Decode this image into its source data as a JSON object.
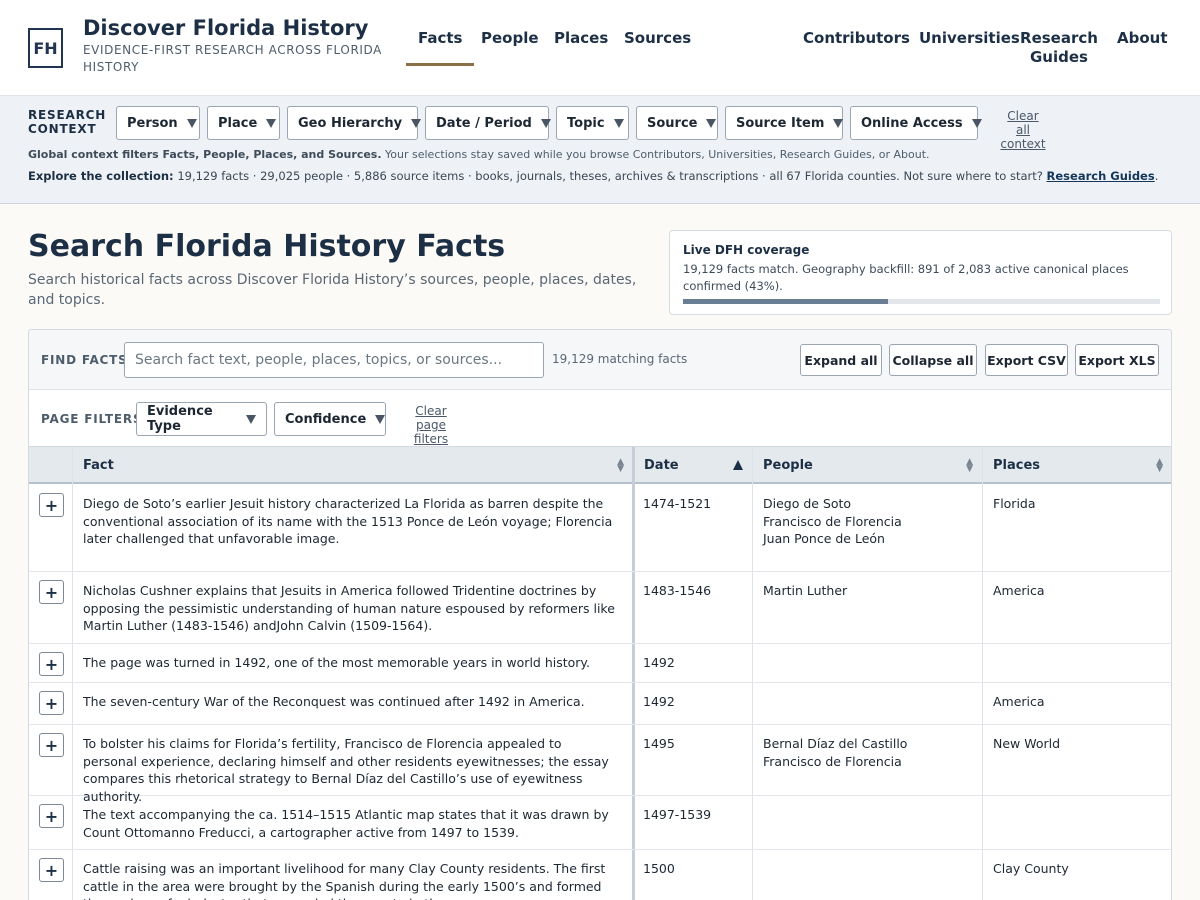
{
  "header": {
    "logo": "FH",
    "title": "Discover Florida History",
    "tagline": "EVIDENCE-FIRST RESEARCH ACROSS FLORIDA HISTORY",
    "nav_primary": [
      "Facts",
      "People",
      "Places",
      "Sources"
    ],
    "nav_secondary": [
      "Contributors",
      "Universities",
      "Research Guides",
      "About"
    ],
    "active_nav": "Facts"
  },
  "context": {
    "label": "RESEARCH CONTEXT",
    "filters": [
      "Person",
      "Place",
      "Geo Hierarchy",
      "Date / Period",
      "Topic",
      "Source",
      "Source Item",
      "Online Access"
    ],
    "clear_label": "Clear all context",
    "note_bold": "Global context filters Facts, People, Places, and Sources.",
    "note_rest": " Your selections stay saved while you browse Contributors, Universities, Research Guides, or About.",
    "stats_label": "Explore the collection:",
    "stats_text": "19,129 facts · 29,025 people · 5,886 source items · books, journals, theses, archives & transcriptions · all 67 Florida counties.  Not sure where to start?",
    "stats_link": "Research Guides",
    "stats_end": "."
  },
  "page": {
    "title": "Search Florida History Facts",
    "subtitle": "Search historical facts across Discover Florida History’s sources, people, places, dates, and topics."
  },
  "coverage": {
    "title": "Live DFH coverage",
    "text": "19,129 facts match. Geography backfill: 891 of 2,083 active canonical places confirmed (43%).",
    "percent": 43
  },
  "find": {
    "label": "FIND FACTS",
    "placeholder": "Search fact text, people, places, topics, or sources...",
    "value": "",
    "count": "19,129 matching facts",
    "expand_all": "Expand all",
    "collapse_all": "Collapse all",
    "export_csv": "Export CSV",
    "export_xls": "Export XLS"
  },
  "page_filters": {
    "label": "PAGE FILTERS",
    "evidence": "Evidence Type",
    "confidence": "Confidence",
    "clear": "Clear page filters"
  },
  "table": {
    "columns": [
      "Fact",
      "Date",
      "People",
      "Places"
    ],
    "sorted_column": "Date",
    "expand_symbol": "+",
    "rows": [
      {
        "fact": "Diego de Soto’s earlier Jesuit history characterized La Florida as barren despite the conventional association of its name with the 1513 Ponce de León voyage; Florencia later challenged that unfavorable image.",
        "date": "1474-1521",
        "people": "Diego de Soto\nFrancisco de Florencia\nJuan Ponce de León",
        "places": "Florida"
      },
      {
        "fact": "Nicholas Cushner explains that Jesuits in America followed Tridentine doctrines by opposing the pessimistic understanding of human nature espoused by reformers like Martin Luther (1483-1546) andJohn Calvin (1509-1564).",
        "date": "1483-1546",
        "people": "Martin Luther",
        "places": "America"
      },
      {
        "fact": "The page was turned in 1492, one of the most memorable years in world history.",
        "date": "1492",
        "people": "",
        "places": ""
      },
      {
        "fact": "The seven-century War of the Reconquest was continued after 1492 in America.",
        "date": "1492",
        "people": "",
        "places": "America"
      },
      {
        "fact": "To bolster his claims for Florida’s fertility, Francisco de Florencia appealed to personal experience, declaring himself and other residents eyewitnesses; the essay compares this rhetorical strategy to Bernal Díaz del Castillo’s use of eyewitness authority.",
        "date": "1495",
        "people": "Bernal Díaz del Castillo\nFrancisco de Florencia",
        "places": "New World"
      },
      {
        "fact": "The text accompanying the ca. 1514–1515 Atlantic map states that it was drawn by Count Ottomanno Freducci, a cartographer active from 1497 to 1539.",
        "date": "1497-1539",
        "people": "",
        "places": ""
      },
      {
        "fact": "Cattle raising was an important livelihood for many Clay County residents. The first cattle in the area were brought by the Spanish during the early 1500’s and formed the nucleus of a industry that expanded the county in the...",
        "date": "1500",
        "people": "",
        "places": "Clay County"
      }
    ]
  }
}
